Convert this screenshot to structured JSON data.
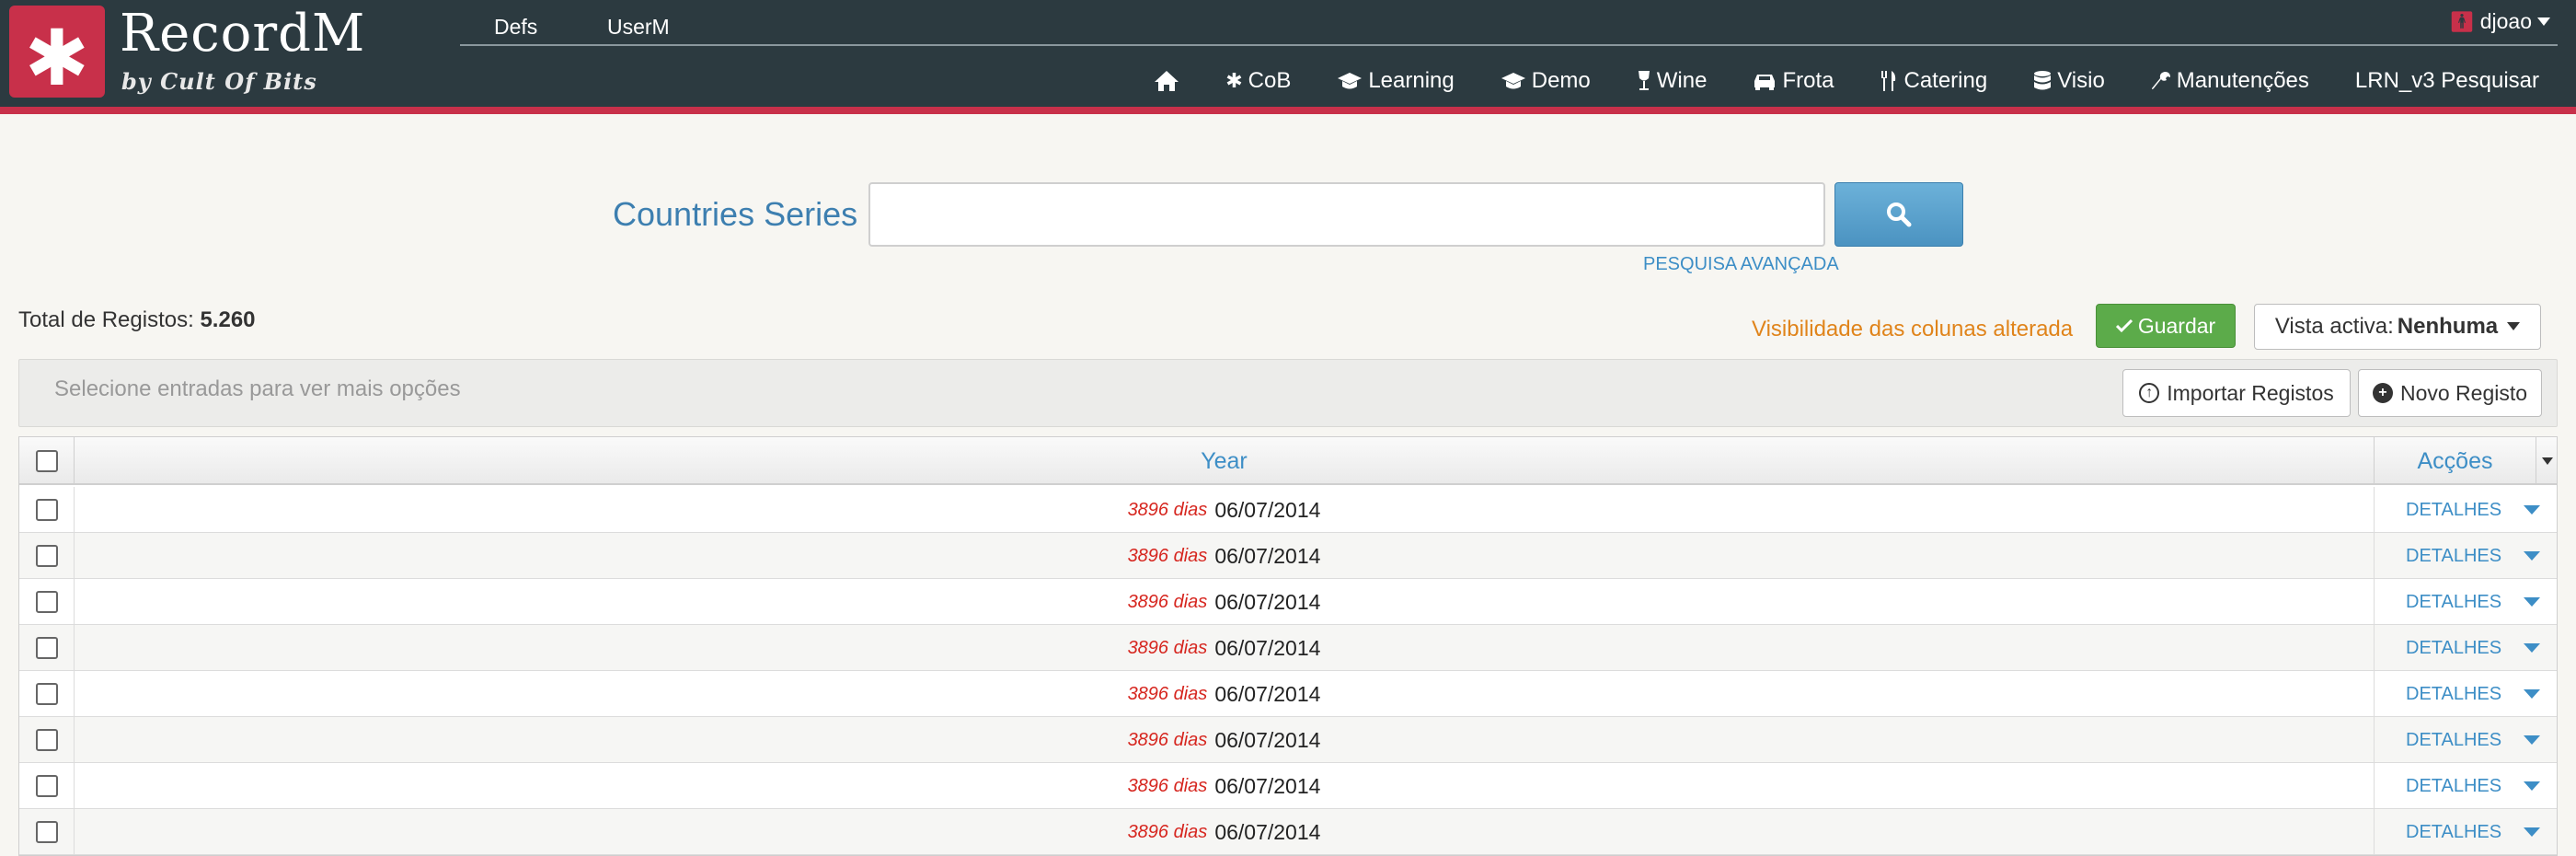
{
  "app": {
    "logo_glyph": "✱",
    "title": "RecordM",
    "subtitle": "by Cult Of Bits"
  },
  "topnav": {
    "items": [
      "Defs",
      "UserM"
    ],
    "user": "djoao"
  },
  "mainnav": {
    "items": [
      {
        "label": "",
        "icon": "home-icon"
      },
      {
        "label": "CoB",
        "icon": "asterisk-icon"
      },
      {
        "label": "Learning",
        "icon": "graduation-cap-icon"
      },
      {
        "label": "Demo",
        "icon": "graduation-cap-icon"
      },
      {
        "label": "Wine",
        "icon": "wine-glass-icon"
      },
      {
        "label": "Frota",
        "icon": "car-icon"
      },
      {
        "label": "Catering",
        "icon": "cutlery-icon"
      },
      {
        "label": "Visio",
        "icon": "database-icon"
      },
      {
        "label": "Manutenções",
        "icon": "wrench-icon"
      },
      {
        "label": "LRN_v3 Pesquisar",
        "icon": ""
      }
    ]
  },
  "search": {
    "label": "Countries Series",
    "value": "",
    "placeholder": "",
    "advanced_link": "PESQUISA AVANÇADA"
  },
  "status": {
    "total_label": "Total de Registos:",
    "total_value": "5.260",
    "visibility_message": "Visibilidade das colunas alterada",
    "save_label": "Guardar",
    "view_label": "Vista activa:",
    "view_value": "Nenhuma"
  },
  "selection_bar": {
    "message": "Selecione entradas para ver mais opções",
    "import_label": "Importar Registos",
    "new_label": "Novo Registo"
  },
  "table": {
    "columns": {
      "year": "Year",
      "actions": "Acções"
    },
    "rows": [
      {
        "days": "3896 dias",
        "date": "06/07/2014",
        "action": "DETALHES"
      },
      {
        "days": "3896 dias",
        "date": "06/07/2014",
        "action": "DETALHES"
      },
      {
        "days": "3896 dias",
        "date": "06/07/2014",
        "action": "DETALHES"
      },
      {
        "days": "3896 dias",
        "date": "06/07/2014",
        "action": "DETALHES"
      },
      {
        "days": "3896 dias",
        "date": "06/07/2014",
        "action": "DETALHES"
      },
      {
        "days": "3896 dias",
        "date": "06/07/2014",
        "action": "DETALHES"
      },
      {
        "days": "3896 dias",
        "date": "06/07/2014",
        "action": "DETALHES"
      },
      {
        "days": "3896 dias",
        "date": "06/07/2014",
        "action": "DETALHES"
      }
    ]
  },
  "colors": {
    "header_bg": "#2c3a40",
    "brand_red": "#c8304a",
    "link_blue": "#3d8ec6",
    "save_green": "#5cab4a",
    "warning_orange": "#e0841b",
    "days_red": "#d6261f"
  }
}
